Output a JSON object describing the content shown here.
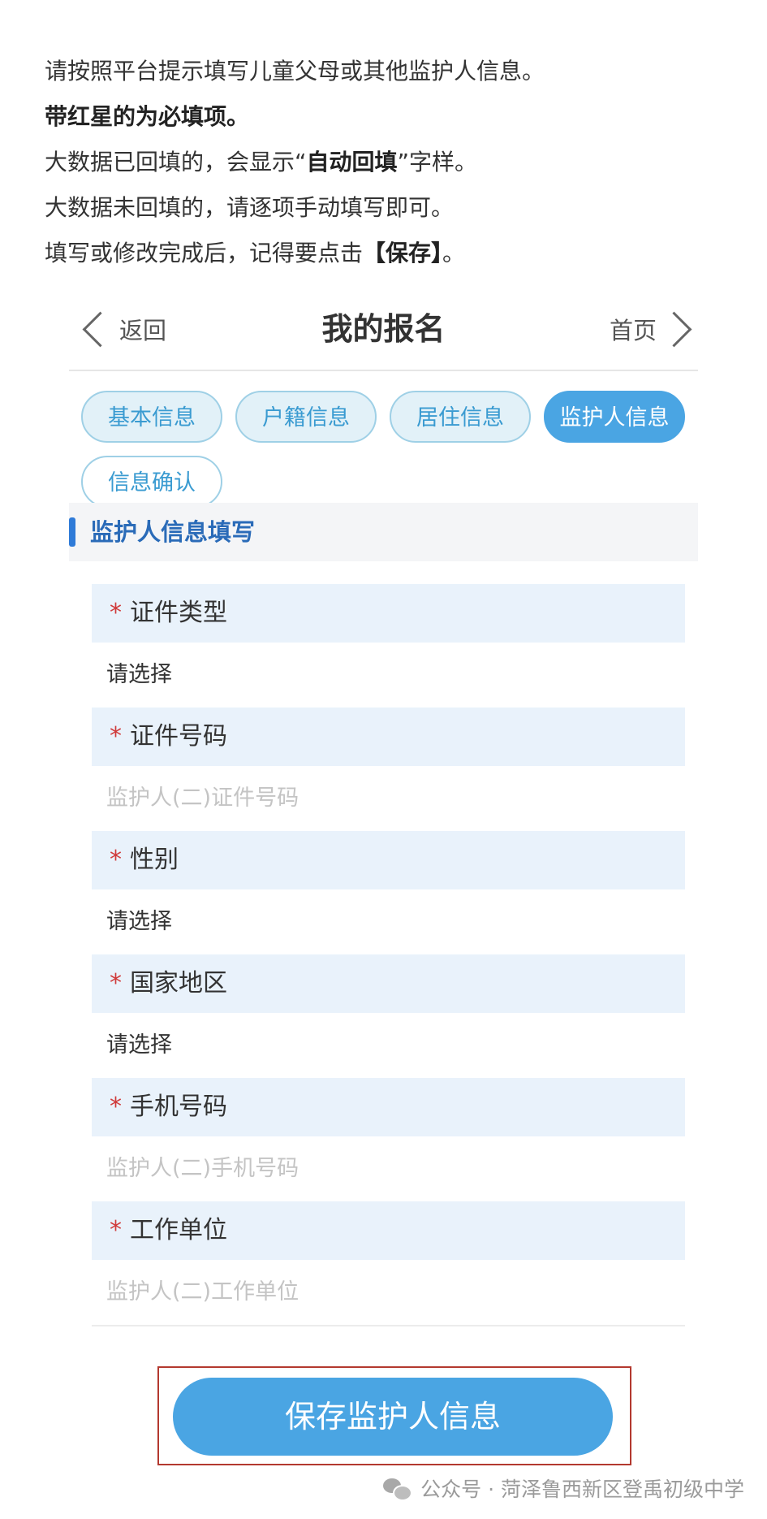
{
  "intro": {
    "line1": "请按照平台提示填写儿童父母或其他监护人信息。",
    "line2_bold": "带红星的为必填项。",
    "line3_pre": "大数据已回填的，会显示“",
    "line3_bold": "自动回填",
    "line3_post": "”字样。",
    "line4": "大数据未回填的，请逐项手动填写即可。",
    "line5_pre": "填写或修改完成后，记得要点击",
    "line5_bold": "【保存】",
    "line5_post": "。"
  },
  "nav": {
    "back_label": "返回",
    "title": "我的报名",
    "home_label": "首页"
  },
  "tabs": [
    "基本信息",
    "户籍信息",
    "居住信息",
    "监护人信息",
    "信息确认"
  ],
  "active_tab": "监护人信息",
  "section_title": "监护人信息填写",
  "required_mark": "*",
  "fields": [
    {
      "label": "证件类型",
      "value": "请选择",
      "is_placeholder": false
    },
    {
      "label": "证件号码",
      "value": "监护人(二)证件号码",
      "is_placeholder": true
    },
    {
      "label": "性别",
      "value": "请选择",
      "is_placeholder": false
    },
    {
      "label": "国家地区",
      "value": "请选择",
      "is_placeholder": false
    },
    {
      "label": "手机号码",
      "value": "监护人(二)手机号码",
      "is_placeholder": true
    },
    {
      "label": "工作单位",
      "value": "监护人(二)工作单位",
      "is_placeholder": true
    }
  ],
  "save_button": "保存监护人信息",
  "footer": {
    "source": "公众号 · 菏泽鲁西新区登禹初级中学"
  },
  "colors": {
    "accent": "#4aa5e3",
    "tab_bg": "#e2f1f8",
    "field_label_bg": "#e9f2fb",
    "required": "#d03a3a",
    "highlight_box": "#b3392f"
  }
}
